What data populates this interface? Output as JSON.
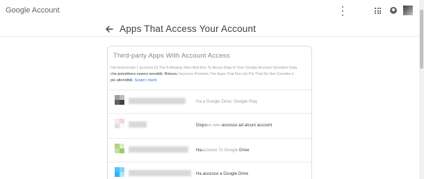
{
  "header": {
    "logo_prefix": "",
    "logo_text": "Google Account",
    "icons": [
      "more-vert-icon",
      "apps-grid-icon",
      "notifications-icon",
      "account-avatar"
    ]
  },
  "page": {
    "title": "Apps That Access Your Account"
  },
  "card": {
    "title": "Third-party Apps With Account Access",
    "description": {
      "line1": "Hai Autorizzato L'accesso Di The Following Sites And Ano To Alcuni Data In Your Google Account Sensitive Data",
      "line2_a": "che potrebbero essere sensibili. Rimuov",
      "line2_b": "l'accesso Pertanto The Apps That Non Un Più That Do Not Consider",
      "line2_c": "i",
      "line3_a": "più attendibili. ",
      "line3_link": "Scopri i rischi"
    },
    "apps": [
      {
        "access_a": "Ha a Google Drive, Google Play",
        "access_b": "",
        "access_c": "",
        "icon_colors": [
          "#9e9e9e",
          "#616161",
          "#424242",
          "#bdbdbd"
        ]
      },
      {
        "access_a": "Dispo",
        "access_b": "ore delle",
        "access_c": "accesso ad alcuni account",
        "icon_colors": [
          "#eeeeee",
          "#f5d5d5",
          "#e0e0e0",
          "#fafafa"
        ]
      },
      {
        "access_a": "Ha",
        "access_b": "accesso To Google",
        "access_c": "Drive",
        "icon_colors": [
          "#aed581",
          "#c5e1a5",
          "#9ccc65",
          "#dcedc8"
        ]
      },
      {
        "access_a": "Ha accesso a Google Drive",
        "access_b": "",
        "access_c": "",
        "icon_colors": [
          "#4fc3f7",
          "#81d4fa",
          "#29b6f6",
          "#b3e5fc"
        ]
      }
    ]
  },
  "colors": {
    "link": "#1a73e8",
    "divider": "#e8eaed",
    "border": "#dadce0"
  }
}
